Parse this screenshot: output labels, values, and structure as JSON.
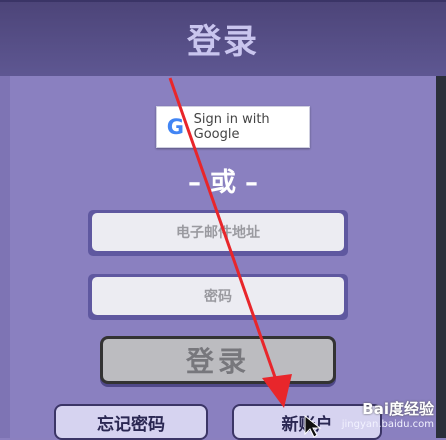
{
  "header": {
    "title": "登录"
  },
  "google_button": {
    "icon": "google-g-icon",
    "icon_glyph": "G",
    "label": "Sign in with Google"
  },
  "divider": {
    "text": "– 或 –"
  },
  "email_field": {
    "placeholder": "电子邮件地址"
  },
  "password_field": {
    "placeholder": "密码"
  },
  "login_button": {
    "label": "登录"
  },
  "forgot_password_button": {
    "label": "忘记密码"
  },
  "new_account_button": {
    "label": "新账户"
  },
  "watermark": {
    "brand": "Bai度经验",
    "url": "jingyan.baidu.com"
  },
  "colors": {
    "background": "#8b80bf",
    "header": "#4c4478",
    "annotation_arrow": "#e8262b"
  }
}
